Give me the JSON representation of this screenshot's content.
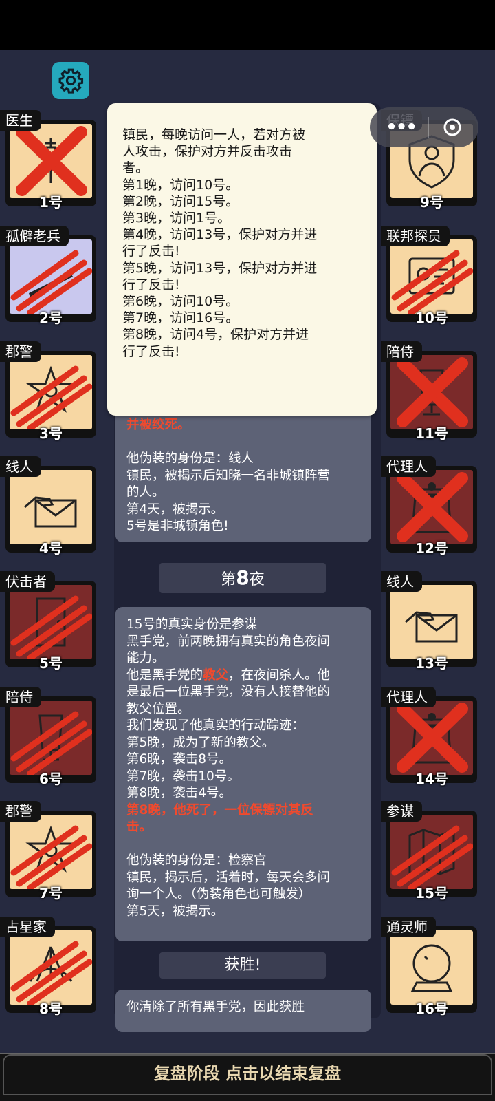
{
  "cards_left": [
    {
      "role": "医生",
      "num": "1号",
      "state": "alive",
      "mark": "cross",
      "icon": "syringe-icon"
    },
    {
      "role": "孤僻老兵",
      "num": "2号",
      "state": "vet",
      "mark": "slash",
      "icon": "rifle-icon"
    },
    {
      "role": "郡警",
      "num": "3号",
      "state": "alive",
      "mark": "slash",
      "icon": "badge-icon"
    },
    {
      "role": "线人",
      "num": "4号",
      "state": "alive",
      "mark": "none",
      "icon": "envelope-icon"
    },
    {
      "role": "伏击者",
      "num": "5号",
      "state": "dead",
      "mark": "slash",
      "icon": "door-icon"
    },
    {
      "role": "陪侍",
      "num": "6号",
      "state": "dead",
      "mark": "slash",
      "icon": "mirror-icon"
    },
    {
      "role": "郡警",
      "num": "7号",
      "state": "alive",
      "mark": "slash",
      "icon": "badge-icon"
    },
    {
      "role": "占星家",
      "num": "8号",
      "state": "alive",
      "mark": "slash",
      "icon": "sextant-icon"
    }
  ],
  "cards_right": [
    {
      "role": "保镖",
      "num": "9号",
      "state": "alive",
      "mark": "none",
      "icon": "bodyguard-shield-icon"
    },
    {
      "role": "联邦探员",
      "num": "10号",
      "state": "alive",
      "mark": "slash",
      "icon": "id-card-icon"
    },
    {
      "role": "陪侍",
      "num": "11号",
      "state": "dead",
      "mark": "cross",
      "icon": "mirror-icon"
    },
    {
      "role": "代理人",
      "num": "12号",
      "state": "dead",
      "mark": "cross",
      "icon": "trenchcoat-icon"
    },
    {
      "role": "线人",
      "num": "13号",
      "state": "alive",
      "mark": "none",
      "icon": "envelope-icon"
    },
    {
      "role": "代理人",
      "num": "14号",
      "state": "dead",
      "mark": "cross",
      "icon": "trenchcoat-icon"
    },
    {
      "role": "参谋",
      "num": "15号",
      "state": "dead",
      "mark": "slash",
      "icon": "map-icon"
    },
    {
      "role": "通灵师",
      "num": "16号",
      "state": "alive",
      "mark": "none",
      "icon": "crystal-ball-icon"
    }
  ],
  "popup": {
    "lines": [
      "镇民，每晚访问一人，若对方被",
      "人攻击，保护对方并反击攻击",
      "者。",
      "第1晚，访问10号。",
      "第2晚，访问15号。",
      "第3晚，访问1号。",
      "第4晚，访问13号，保护对方并进",
      "行了反击!",
      "第5晚，访问13号，保护对方并进",
      "行了反击!",
      "第6晚，访问10号。",
      "第7晚，访问16号。",
      "第8晚，访问4号，保护对方并进",
      "行了反击!"
    ]
  },
  "panel1": {
    "red_line": "并被绞死。",
    "lines": [
      "",
      "他伪装的身份是：线人",
      "镇民，被揭示后知晓一名非城镇阵营",
      "的人。",
      "第4天，被揭示。",
      "5号是非城镇角色!"
    ]
  },
  "header_night": {
    "prefix": "第",
    "num": "8",
    "suffix": "夜"
  },
  "panel2": {
    "l1": "15号的真实身份是参谋",
    "l2": "黑手党，前两晚拥有真实的角色夜间",
    "l3": "能力。",
    "l4a": "他是黑手党的",
    "l4b": "教父",
    "l4c": "，在夜间杀人。他",
    "l5": "是最后一位黑手党，没有人接替他的",
    "l6": "教父位置。",
    "l7": "我们发现了他真实的行动踪迹：",
    "l8": "第5晚，成为了新的教父。",
    "l9": "第6晚，袭击8号。",
    "l10": "第7晚，袭击10号。",
    "l11": "第8晚，袭击4号。",
    "l12": "第8晚，他死了，一位保镖对其反",
    "l13": "击。",
    "l14": "",
    "l15": "他伪装的身份是：检察官",
    "l16": "镇民，揭示后，活着时，每天会多问",
    "l17": "询一个人。（伪装角色也可触发）",
    "l18": "第5天，被揭示。"
  },
  "header_win": "获胜!",
  "panel3": "你清除了所有黑手党，因此获胜",
  "bottom": "复盘阶段 点击以结束复盘",
  "colors": {
    "alive": "#f7d7a3",
    "dead": "#7b2a2a",
    "mark": "#e0301e",
    "accent_red": "#f04a2e"
  }
}
